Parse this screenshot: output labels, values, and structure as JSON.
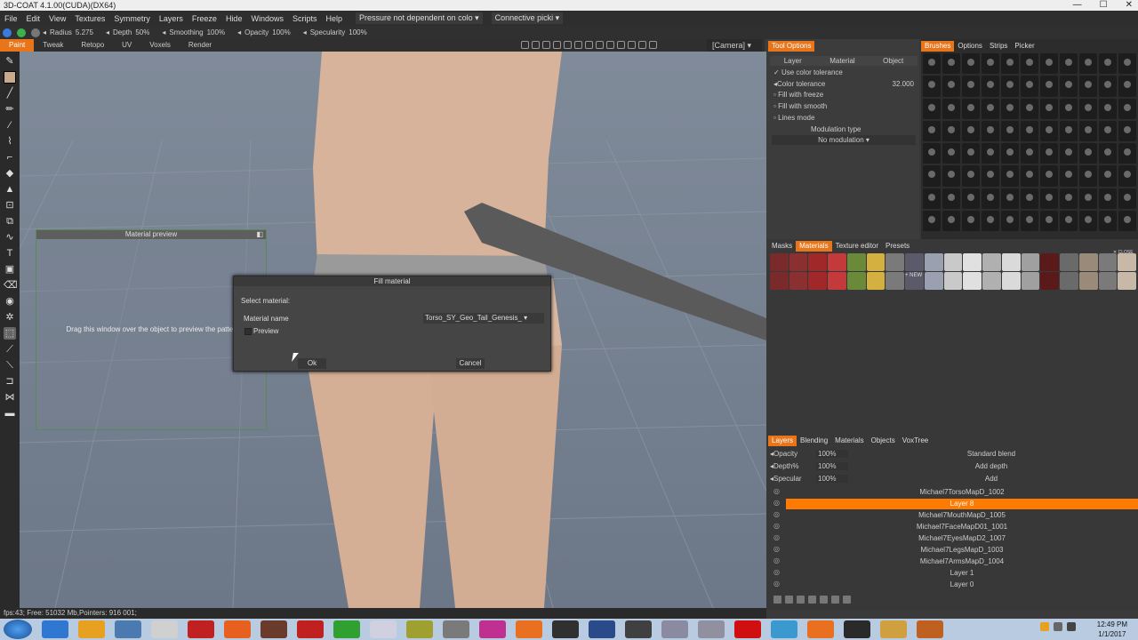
{
  "window": {
    "title": "3D-COAT 4.1.00(CUDA)(DX64)",
    "min": "—",
    "max": "☐",
    "close": "✕"
  },
  "menu": [
    "File",
    "Edit",
    "View",
    "Textures",
    "Symmetry",
    "Layers",
    "Freeze",
    "Hide",
    "Windows",
    "Scripts",
    "Help"
  ],
  "menu_dropdowns": [
    "Pressure not dependent on colo",
    "Connective picki"
  ],
  "toolbar": [
    {
      "label": "Radius",
      "value": "5.275"
    },
    {
      "label": "Depth",
      "value": "50%"
    },
    {
      "label": "Smoothing",
      "value": "100%"
    },
    {
      "label": "Opacity",
      "value": "100%"
    },
    {
      "label": "Specularity",
      "value": "100%"
    }
  ],
  "room_tabs": [
    "Paint",
    "Tweak",
    "Retopo",
    "UV",
    "Voxels",
    "Render"
  ],
  "camera": "[Camera]",
  "material_preview": {
    "title": "Material preview",
    "hint": "Drag this window over the object to preview the pattern."
  },
  "fill_material": {
    "title": "Fill material",
    "select_label": "Select material:",
    "name_label": "Material name",
    "name_value": "Torso_SY_Geo_Tail_Genesis_",
    "preview_label": "Preview",
    "ok": "Ok",
    "cancel": "Cancel"
  },
  "tool_options": {
    "title": "Tool Options",
    "subtabs": [
      "Layer",
      "Material",
      "Object"
    ],
    "use_color_tolerance": "Use color tolerance",
    "color_tolerance_label": "Color tolerance",
    "color_tolerance_value": "32.000",
    "fill_with_freeze": "Fill with freeze",
    "fill_with_smooth": "Fill with smooth",
    "lines_mode": "Lines mode",
    "modulation_type": "Modulation type",
    "modulation_value": "No modulation"
  },
  "brush_tabs": [
    "Brushes",
    "Options",
    "Strips",
    "Picker"
  ],
  "material_tabs": [
    "Masks",
    "Materials",
    "Texture editor",
    "Presets"
  ],
  "material_new_label": "NEW",
  "material_close_label": "CLOSE",
  "layers_panel": {
    "tabs": [
      "Layers",
      "Blending",
      "Materials",
      "Objects",
      "VoxTree"
    ],
    "props": [
      {
        "label": "Opacity",
        "value": "100%",
        "mode": "Standard blend"
      },
      {
        "label": "Depth%",
        "value": "100%",
        "mode": "Add depth"
      },
      {
        "label": "Specular",
        "value": "100%",
        "mode": "Add"
      }
    ],
    "layers": [
      "Michael7TorsoMapD_1002",
      "Layer 8",
      "Michael7MouthMapD_1005",
      "Michael7FaceMapD01_1001",
      "Michael7EyesMapD2_1007",
      "Michael7LegsMapD_1003",
      "Michael7ArmsMapD_1004",
      "Layer 1",
      "Layer 0"
    ],
    "selected_layer": "Layer 8"
  },
  "status": "fps:43;   Free: 51032 Mb,Pointers: 916 001;",
  "clock": {
    "time": "12:49 PM",
    "date": "1/1/2017"
  },
  "taskbar_apps": [
    "ie-icon",
    "media-player-icon",
    "virtualbox-icon",
    "calculator-icon",
    "adobe-icon",
    "firefox-icon",
    "game-icon",
    "adobe-2-icon",
    "green-app-icon",
    "explorer-icon",
    "audio-icon",
    "pen-icon",
    "render-icon",
    "vlc-icon",
    "camera-icon",
    "lightroom-icon",
    "cursor-icon",
    "virtual-icon",
    "photo-icon",
    "k-icon",
    "chrome-icon",
    "blender-icon",
    "daz-icon",
    "folder-icon",
    "firefox-2-icon"
  ],
  "colors": {
    "accent": "#e8751a",
    "selected_layer": "#ff7a00",
    "swatch": "#c8a98c"
  }
}
